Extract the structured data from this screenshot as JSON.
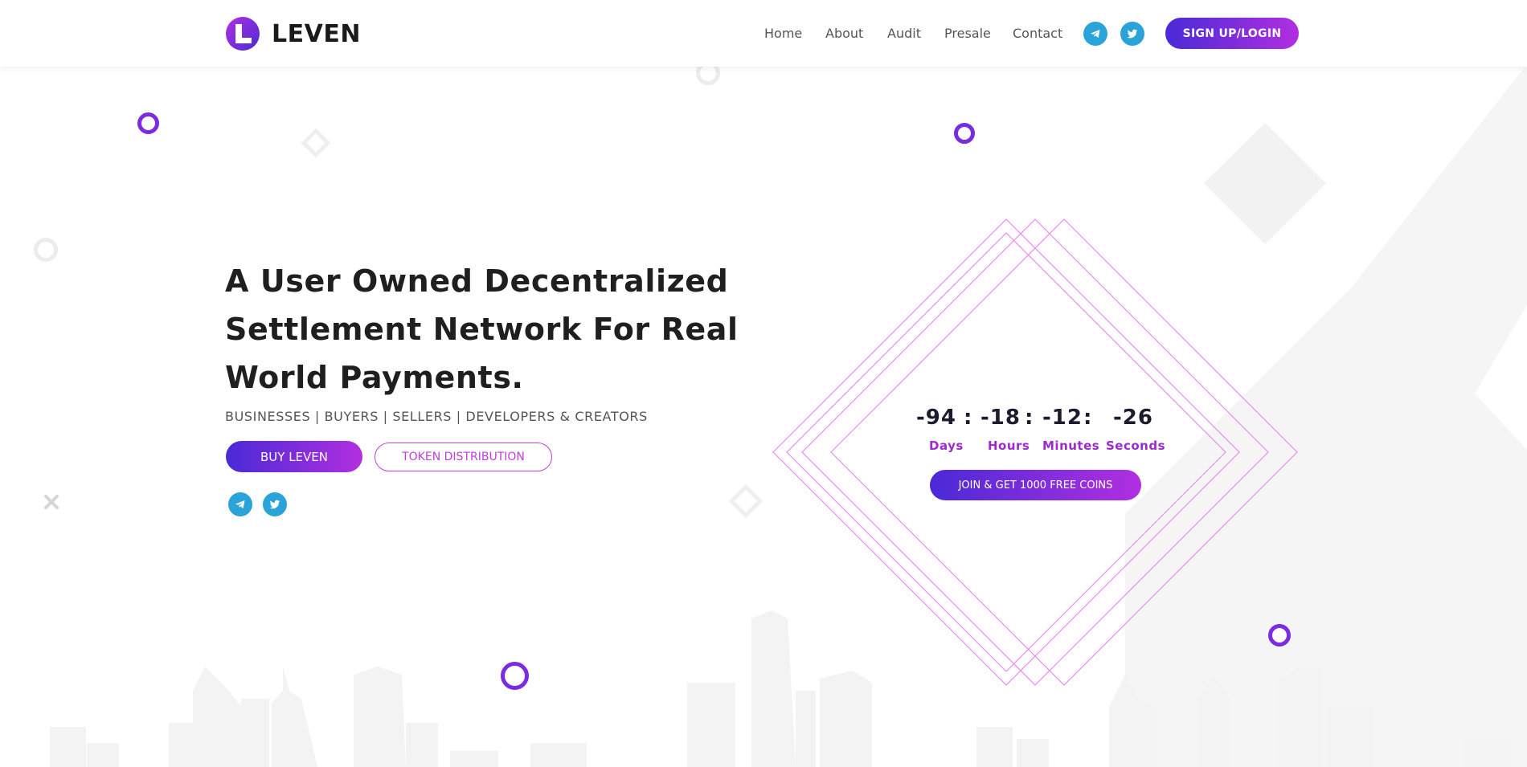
{
  "header": {
    "brand": "LEVEN",
    "nav": [
      "Home",
      "About",
      "Audit",
      "Presale",
      "Contact"
    ],
    "social_icons": [
      "telegram-icon",
      "twitter-icon"
    ],
    "signup_label": "SIGN UP/LOGIN"
  },
  "hero": {
    "title": "A User Owned Decentralized Settlement Network For Real World Payments.",
    "subtitle": "BUSINESSES | BUYERS | SELLERS | DEVELOPERS & CREATORS",
    "buy_label": "BUY LEVEN",
    "token_label": "TOKEN DISTRIBUTION",
    "social_icons": [
      "telegram-icon",
      "twitter-icon"
    ]
  },
  "countdown": {
    "days": "-94",
    "hours": "-18",
    "minutes": "-12",
    "seconds": "-26",
    "separator": ":",
    "labels": {
      "days": "Days",
      "hours": "Hours",
      "minutes": "Minutes",
      "seconds": "Seconds"
    },
    "join_label": "JOIN & GET 1000 FREE COINS"
  },
  "colors": {
    "accent_start": "#4a2ad6",
    "accent_end": "#b12fe0",
    "social": "#2aa3d8",
    "diamond_outline": "#e98af5"
  }
}
